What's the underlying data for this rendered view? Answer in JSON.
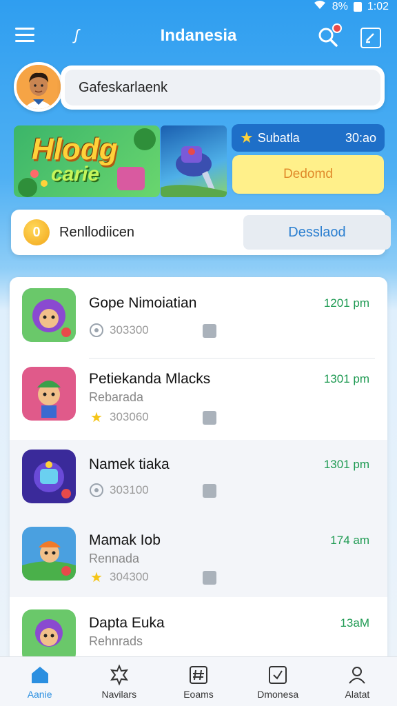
{
  "status": {
    "signal": "8%",
    "time": "1:02"
  },
  "header": {
    "title": "Indanesia",
    "logo": "ʃ"
  },
  "search": {
    "value": "Gafeskarlaenk"
  },
  "banner": {
    "title_line1": "Hlodg",
    "title_line2": "carie"
  },
  "promo": {
    "label": "Subatla",
    "value": "30:ao",
    "button": "Dedomd"
  },
  "coins": {
    "coin_symbol": "0",
    "label": "Renllodiicen",
    "button": "Desslaod"
  },
  "apps": [
    {
      "name": "Gope Nimoiatian",
      "subtitle": "",
      "stat": "303300",
      "time": "1201 pm",
      "stat_icon": "chat-icon"
    },
    {
      "name": "Petiekanda Mlacks",
      "subtitle": "Rebarada",
      "stat": "303060",
      "time": "1301 pm",
      "stat_icon": "star-icon"
    },
    {
      "name": "Namek tiaka",
      "subtitle": "",
      "stat": "303100",
      "time": "1301 pm",
      "stat_icon": "chat-icon"
    },
    {
      "name": "Mamak Iob",
      "subtitle": "Rennada",
      "stat": "304300",
      "time": "174 am",
      "stat_icon": "star-icon"
    },
    {
      "name": "Dapta Euka",
      "subtitle": "Rehnrads",
      "stat": "",
      "time": "13aM",
      "stat_icon": ""
    }
  ],
  "nav": [
    {
      "label": "Aanie",
      "icon": "home-icon"
    },
    {
      "label": "Navilars",
      "icon": "badge-icon"
    },
    {
      "label": "Eoams",
      "icon": "hash-icon"
    },
    {
      "label": "Dmonesa",
      "icon": "check-box-icon"
    },
    {
      "label": "Alatat",
      "icon": "profile-icon"
    }
  ],
  "colors": {
    "primary": "#2f9ef0",
    "accent_green": "#1e9a52",
    "promo_yellow": "#fff08a"
  }
}
